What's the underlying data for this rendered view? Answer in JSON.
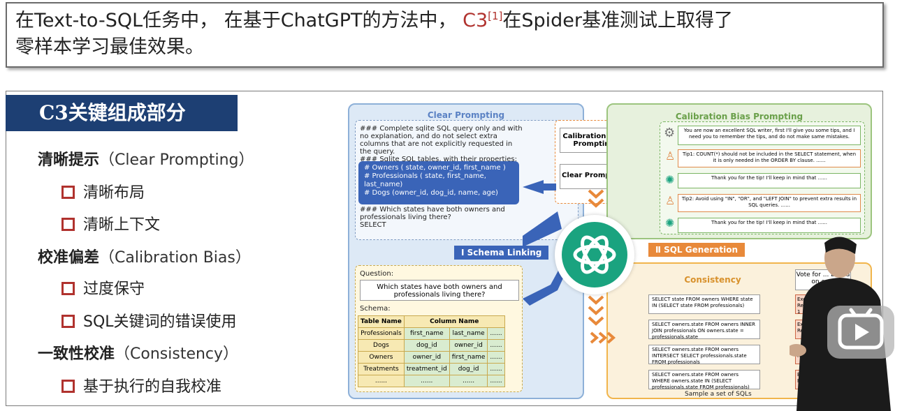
{
  "banner": {
    "line1_pre": "在Text-to-SQL任务中， 在基于ChatGPT的方法中， ",
    "c3": "C3",
    "cite": "[1]",
    "line1_post": "在Spider基准测试上取得了",
    "line2": "零样本学习最佳效果。"
  },
  "title": "C3关键组成部分",
  "list": [
    {
      "zh": "清晰提示",
      "en": "（Clear Prompting）"
    },
    {
      "sub": "清晰布局"
    },
    {
      "sub": "清晰上下文"
    },
    {
      "zh": "校准偏差",
      "en": "（Calibration Bias）"
    },
    {
      "sub": "过度保守"
    },
    {
      "sub": "SQL关键词的错误使用"
    },
    {
      "zh": "一致性校准",
      "en": "（Consistency）"
    },
    {
      "sub": "基于执行的自我校准"
    }
  ],
  "diagram": {
    "clear_title": "Clear Prompting",
    "calib_title": "Calibration Bias Prompting",
    "consistency_title": "Consistency",
    "code_top": "### Complete sqlite SQL query only and with no explanation, and do not select extra columns that are not explicitly requested in the query.\n### Sqlite SQL tables, with their properties:\n#",
    "code_blue": "# Owners ( state, owner_id, first_name )\n# Professionals ( state, first_name, last_name)\n# Dogs (owner_id, dog_id, name, age)",
    "code_bottom": "### Which states have both owners and professionals living there?\nSELECT",
    "tag_schema": "Ⅰ Schema Linking",
    "tag_sqlgen": "Ⅱ SQL Generation",
    "box_calib": "Calibration Bias Prompting",
    "box_clear": "Clear Prompting",
    "question_label": "Question:",
    "question_text": "Which states have both owners and professionals living there?",
    "schema_label": "Schema:",
    "table_header": [
      "Table Name",
      "Column Name"
    ],
    "table_rows": [
      [
        "Professionals",
        "first_name",
        "last_name",
        "......"
      ],
      [
        "Dogs",
        "dog_id",
        "owner_id",
        "......"
      ],
      [
        "Owners",
        "owner_id",
        "first_name",
        "......"
      ],
      [
        "Treatments",
        "treatment_id",
        "dog_id",
        "......"
      ],
      [
        "......",
        "......",
        "......",
        "......"
      ]
    ],
    "calib_rows": [
      "You are now an excellent SQL writer, first I'll give you some tips, and I need you to remember the tips, and do not make same mistakes.",
      "Tip1: COUNT(*) should not be included in the SELECT statement, when it is only needed in the ORDER BY clause. ......",
      "Thank you for the tip! I'll keep in mind that ......",
      "Tip2: Avoid using \"IN\", \"OR\", and \"LEFT JOIN\" to prevent extra results in SQL queries. ......",
      "Thank you for the tip! I'll keep in mind that ......"
    ],
    "sql_rows": [
      "SELECT state FROM owners WHERE state IN (SELECT state FROM professionals)",
      "SELECT owners.state FROM owners INNER JOIN professionals ON owners.state = professionals.state",
      "SELECT owners.state FROM owners INTERSECT SELECT professionals.state FROM professionals",
      "SELECT owners.state FROM owners WHERE owners.state IN (SELECT professionals.state FROM professionals)"
    ],
    "exec_rows": [
      "Execution Result 1",
      "Execution Res...",
      "Execution Res...",
      "Execution Resu..."
    ],
    "vote_text": "Vote for ... based on ex...",
    "sample_text": "Sample a set of SQLs"
  },
  "colors": {
    "title_bg": "#1d3f73",
    "accent_red": "#b0322e",
    "clear_bg": "#dde9f6",
    "calib_bg": "#e7f1dd",
    "sqlgen_bg": "#fbf1dc",
    "tag_blue": "#3a64b8",
    "tag_orange": "#e8893a",
    "openai_green": "#1aa37f"
  }
}
